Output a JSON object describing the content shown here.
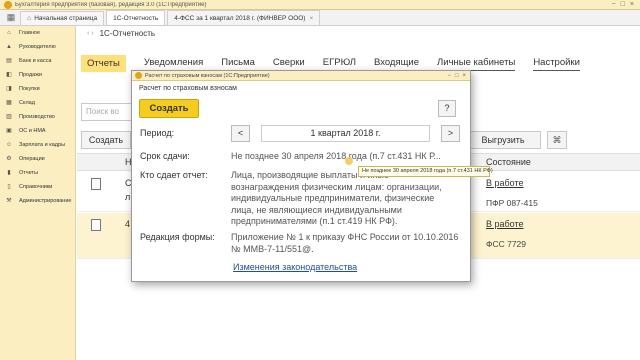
{
  "window": {
    "title": "Бухгалтерия предприятия (базовая), редакция 3.0  (1С:Предприятие)",
    "buttons": [
      "−",
      "□",
      "×"
    ]
  },
  "tabs": [
    {
      "label": "Начальная страница"
    },
    {
      "label": "1С-Отчетность"
    },
    {
      "label": "4-ФСС за 1 квартал 2018 г. (ФИНВЕР ООО)"
    }
  ],
  "sidebar": {
    "items": [
      {
        "icon": "home-icon",
        "glyph": "⌂",
        "label": "Главное"
      },
      {
        "icon": "chart-icon",
        "glyph": "▲",
        "label": "Руководителю"
      },
      {
        "icon": "bank-icon",
        "glyph": "▤",
        "label": "Банк и касса"
      },
      {
        "icon": "cart-icon",
        "glyph": "◧",
        "label": "Продажи"
      },
      {
        "icon": "purchase-icon",
        "glyph": "◨",
        "label": "Покупки"
      },
      {
        "icon": "warehouse-icon",
        "glyph": "▦",
        "label": "Склад"
      },
      {
        "icon": "factory-icon",
        "glyph": "▥",
        "label": "Производство"
      },
      {
        "icon": "assets-icon",
        "glyph": "▣",
        "label": "ОС и НМА"
      },
      {
        "icon": "payroll-icon",
        "glyph": "☺",
        "label": "Зарплата и кадры"
      },
      {
        "icon": "operations-icon",
        "glyph": "⚙",
        "label": "Операции"
      },
      {
        "icon": "reports-icon",
        "glyph": "▮",
        "label": "Отчеты"
      },
      {
        "icon": "book-icon",
        "glyph": "▯",
        "label": "Справочники"
      },
      {
        "icon": "admin-icon",
        "glyph": "⚒",
        "label": "Администрирование"
      }
    ]
  },
  "main": {
    "title": "1С-Отчетность",
    "menu": [
      "Отчеты",
      "Уведомления",
      "Письма",
      "Сверки",
      "ЕГРЮЛ",
      "Входящие",
      "Личные кабинеты",
      "Настройки"
    ],
    "search_placeholder": "Поиск во",
    "create_label": "Создать",
    "export_label": "Выгрузить",
    "col_n": "Н",
    "col_state": "Состояние",
    "rows": [
      {
        "frag1": "С",
        "frag2": "л",
        "state": "В работе",
        "code": "ПФР 087-415"
      },
      {
        "frag1": "4",
        "frag2": "",
        "state": "В работе",
        "code": "ФСС 7729"
      }
    ]
  },
  "modal": {
    "window_title": "Расчет по страховым взносам  (1С:Предприятие)",
    "heading": "Расчет по страховым взносам",
    "create_label": "Создать",
    "help_label": "?",
    "period_label": "Период:",
    "period_value": "1 квартал 2018 г.",
    "prev_label": "<",
    "next_label": ">",
    "deadline_label": "Срок сдачи:",
    "deadline_value": "Не позднее 30 апреля 2018 года (п.7 ст.431 НК Р...",
    "who_label": "Кто сдает отчет:",
    "who_value": "Лица, производящие выплаты и иные вознаграждения физическим лицам: организации, индивидуальные предприниматели, физические лица, не являющиеся индивидуальными предпринимателями (п.1 ст.419 НК РФ).",
    "form_label": "Редакция формы:",
    "form_value": "Приложение № 1 к приказу ФНС России от 10.10.2016 № ММВ-7-11/551@.",
    "law_link": "Изменения законодательства"
  },
  "tooltip": "Не позднее 30 апреля 2018 года (п.7 ст.431 НК РФ)",
  "colors": {
    "accent": "#f5cd1f",
    "sidebar": "#fbeec1",
    "link": "#1f4f98"
  }
}
